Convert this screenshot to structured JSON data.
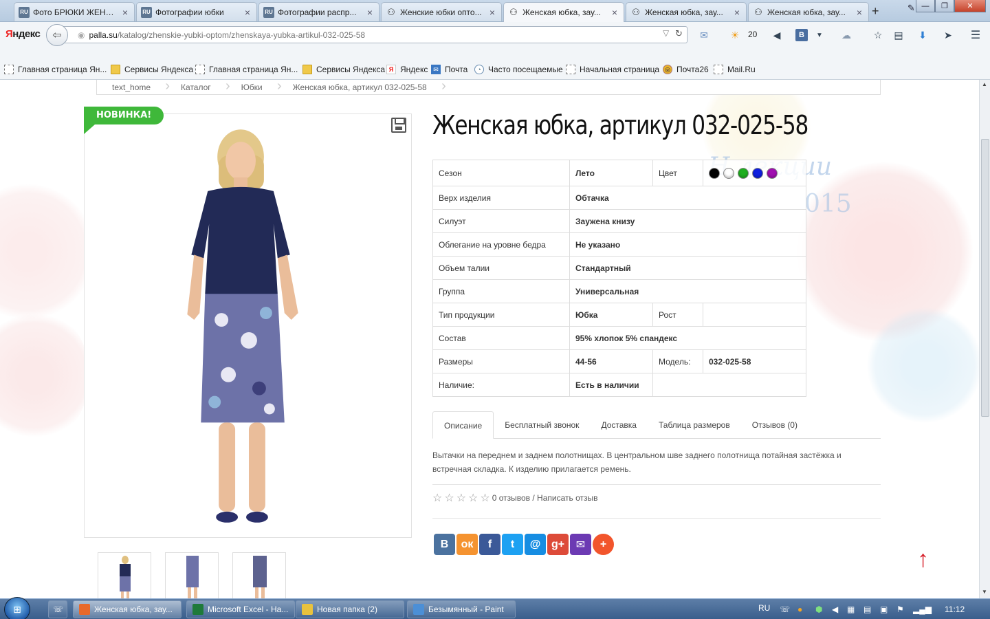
{
  "browser": {
    "tabs": [
      {
        "icon": "ru-icon",
        "title": "Фото БРЮКИ ЖЕНС...",
        "active": false
      },
      {
        "icon": "ru-icon",
        "title": "Фотографии юбки",
        "active": false
      },
      {
        "icon": "ru-icon",
        "title": "Фотографии распр...",
        "active": false
      },
      {
        "icon": "people-icon",
        "title": "Женские юбки опто...",
        "active": false
      },
      {
        "icon": "people-icon",
        "title": "Женская юбка, зау...",
        "active": true
      },
      {
        "icon": "people-icon",
        "title": "Женская юбка, зау...",
        "active": false
      },
      {
        "icon": "people-icon",
        "title": "Женская юбка, зау...",
        "active": false
      }
    ],
    "new_tab": "+",
    "logo_first": "Я",
    "logo_rest": "ндекс",
    "url_host": "palla.su",
    "url_path": "/katalog/zhenskie-yubki-optom/zhenskaya-yubka-artikul-032-025-58",
    "weather_temp": "20",
    "vk_label": "В"
  },
  "bookmarks": [
    {
      "icon": "page",
      "label": "Главная страница Ян..."
    },
    {
      "icon": "folder",
      "label": "Сервисы Яндекса"
    },
    {
      "icon": "page",
      "label": "Главная страница Ян..."
    },
    {
      "icon": "folder",
      "label": "Сервисы Яндекса"
    },
    {
      "icon": "ya",
      "label": "Яндекс"
    },
    {
      "icon": "mail",
      "label": "Почта"
    },
    {
      "icon": "circ",
      "label": "Часто посещаемые"
    },
    {
      "icon": "page",
      "label": "Начальная страница"
    },
    {
      "icon": "p26",
      "label": "Почта26"
    },
    {
      "icon": "page",
      "label": "Mail.Ru"
    }
  ],
  "breadcrumb": [
    "text_home",
    "Каталог",
    "Юбки",
    "Женская юбка, артикул 032-025-58"
  ],
  "badge_new": "НОВИНКА!",
  "product_title": "Женская юбка, артикул 032-025-58",
  "bg_decor": {
    "line1": "Н     лекции",
    "line2": "015"
  },
  "specs": {
    "season_label": "Сезон",
    "season": "Лето",
    "color_label": "Цвет",
    "colors": [
      "#000000",
      "#ffffff",
      "#1fae1f",
      "#1020e0",
      "#a010b0"
    ],
    "top_label": "Верх изделия",
    "top": "Обтачка",
    "silhouette_label": "Силуэт",
    "silhouette": "Заужена книзу",
    "hip_label": "Облегание на уровне бедра",
    "hip": "Не указано",
    "waist_label": "Объем талии",
    "waist": "Стандартный",
    "group_label": "Группа",
    "group": "Универсальная",
    "type_label": "Тип продукции",
    "type": "Юбка",
    "height_label": "Рост",
    "height": "",
    "composition_label": "Состав",
    "composition": "95% хлопок 5% спандекс",
    "sizes_label": "Размеры",
    "sizes": "44-56",
    "model_label": "Модель:",
    "model": "032-025-58",
    "availability_label": "Наличие:",
    "availability": "Есть в наличии"
  },
  "product_tabs": [
    "Описание",
    "Бесплатный звонок",
    "Доставка",
    "Таблица размеров",
    "Отзывов (0)"
  ],
  "description": "Вытачки на переднем и заднем полотнищах. В центральном шве заднего полотнища потайная застёжка и встречная складка. К изделию прилагается ремень.",
  "reviews_text": "0 отзывов / Написать отзыв",
  "share_buttons": [
    {
      "name": "vk",
      "glyph": "В",
      "color": "#4b729f"
    },
    {
      "name": "odnoklassniki",
      "glyph": "ок",
      "color": "#f59330"
    },
    {
      "name": "facebook",
      "glyph": "f",
      "color": "#3b5998"
    },
    {
      "name": "twitter",
      "glyph": "t",
      "color": "#1da1f2"
    },
    {
      "name": "mailru",
      "glyph": "@",
      "color": "#168de2"
    },
    {
      "name": "googleplus",
      "glyph": "g+",
      "color": "#dd4b39"
    },
    {
      "name": "email",
      "glyph": "✉",
      "color": "#6c3ab3"
    },
    {
      "name": "more",
      "glyph": "+",
      "color": "#f2552c"
    }
  ],
  "taskbar": {
    "items": [
      {
        "label": "Женская юбка, зау...",
        "icon_color": "#e8692b",
        "active": true
      },
      {
        "label": "Microsoft Excel - На...",
        "icon_color": "#1e7a3a",
        "active": false
      },
      {
        "label": "Новая папка (2)",
        "icon_color": "#e9c23d",
        "active": false
      },
      {
        "label": "Безымянный - Paint",
        "icon_color": "#4c8fd6",
        "active": false
      }
    ],
    "lang": "RU",
    "time": "11:12"
  }
}
